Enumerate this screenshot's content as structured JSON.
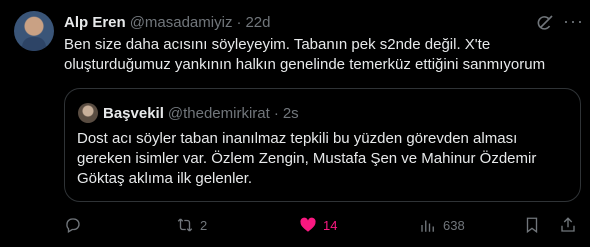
{
  "tweet": {
    "author_name": "Alp Eren",
    "handle": "@masadamiyiz",
    "separator": "·",
    "time": "22d",
    "text_lines": [
      "Ben size daha acısını söyleyeyim. Tabanın pek s2nde değil. X'te",
      "oluşturduğumuz yankının halkın genelinde temerküz ettiğini sanmıyorum"
    ]
  },
  "quote": {
    "author_name": "Başvekil",
    "handle": "@thedemirkirat",
    "separator": "·",
    "time": "2s",
    "text_lines": [
      "Dost acı söyler taban inanılmaz tepkili bu yüzden görevden alması",
      "gereken isimler var. Özlem Zengin, Mustafa Şen ve Mahinur Özdemir",
      "Göktaş aklıma ilk gelenler."
    ]
  },
  "actions": {
    "replies": "",
    "reposts": "2",
    "likes": "14",
    "views": "638"
  },
  "icons": {
    "more": "more-horizontal-icon",
    "grok": "grok-icon",
    "reply": "reply-icon",
    "repost": "repost-icon",
    "like": "heart-icon",
    "views": "views-icon",
    "bookmark": "bookmark-icon",
    "share": "share-icon"
  },
  "colors": {
    "background": "#000000",
    "text": "#e7e9ea",
    "secondary": "#71767b",
    "like_active": "#f91880",
    "border": "#2f3336"
  }
}
